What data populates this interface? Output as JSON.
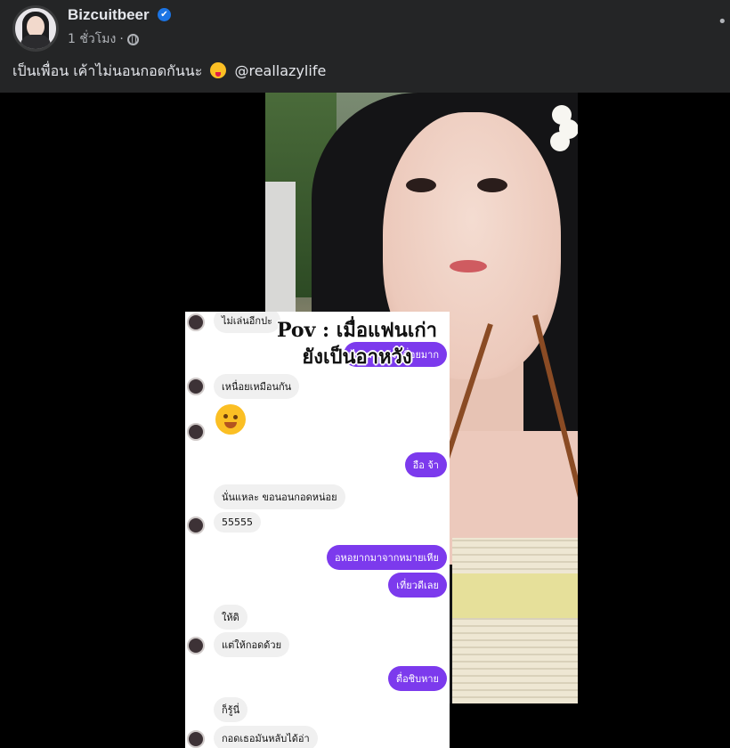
{
  "post": {
    "author": "Bizcuitbeer",
    "verified_icon": "✔",
    "timestamp": "1 ชั่วโมง",
    "separator": "·",
    "more_icon": "•••",
    "caption_text": "เป็นเพื่อน เค้าไม่นอนกอดกันนะ",
    "caption_mention": "@reallazylife"
  },
  "image": {
    "overlay_title_line1": "Pov : เมื่อแฟนเก่า",
    "overlay_title_line2": "ยังเป็นอาหวัง"
  },
  "chat": {
    "messages": [
      {
        "side": "in",
        "text": "ไม่เล่นอีกปะ"
      },
      {
        "side": "out",
        "text": "ไม่เล่นแล้ว เมื่อยมาก"
      },
      {
        "side": "in",
        "text": "เหนื่อยเหมือนกัน"
      },
      {
        "side": "out",
        "text": "อือ จ้า"
      },
      {
        "side": "in",
        "text": "นั่นแหละ ขอนอนกอดหน่อย"
      },
      {
        "side": "in",
        "text": "55555"
      },
      {
        "side": "out",
        "text": "อหอยากมาจากหมายเหีย"
      },
      {
        "side": "out",
        "text": "เที่ยวดีเลย"
      },
      {
        "side": "in",
        "text": "ให้ดิ"
      },
      {
        "side": "in",
        "text": "แต่ให้กอดด้วย"
      },
      {
        "side": "out",
        "text": "ตื่อชิบหาย"
      },
      {
        "side": "in",
        "text": "ก็รู้นี่"
      },
      {
        "side": "in",
        "text": "กอดเธอมันหลับได้อ่า"
      }
    ]
  },
  "colors": {
    "header_bg": "#242526",
    "verified_blue": "#1b74e4",
    "bubble_out": "#7c3aed",
    "bubble_in": "#f0f0f0"
  }
}
